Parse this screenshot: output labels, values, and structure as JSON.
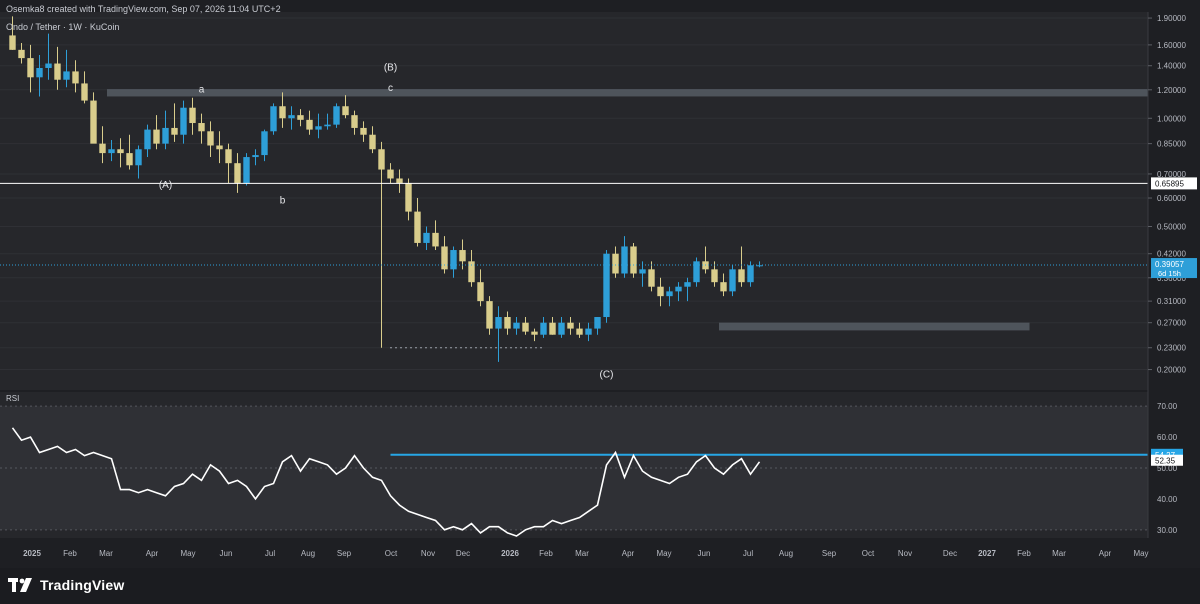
{
  "header": {
    "credit": "Osemka8 created with TradingView.com, Sep 07, 2026 11:04 UTC+2"
  },
  "footer": {
    "brand": "TradingView"
  },
  "colors": {
    "background": "#1e1f23",
    "panel": "#26272b",
    "bull": "#2e9fd8",
    "bear": "#d9cd8c",
    "rsi_line": "#ffffff",
    "highlight": "#27a6e6",
    "zone": "#6f7a84"
  },
  "chart_data": [
    {
      "type": "candlestick",
      "title": "Ondo / Tether · 1W · KuCoin",
      "scale": "log",
      "ylim": [
        0.18,
        1.95
      ],
      "y_ticks": [
        "1.90000",
        "1.60000",
        "1.40000",
        "1.20000",
        "1.00000",
        "0.85000",
        "0.70000",
        "0.60000",
        "0.50000",
        "0.42000",
        "0.36000",
        "0.31000",
        "0.27000",
        "0.23000",
        "0.20000"
      ],
      "y_tick_values": [
        1.9,
        1.6,
        1.4,
        1.2,
        1.0,
        0.85,
        0.7,
        0.6,
        0.5,
        0.42,
        0.36,
        0.31,
        0.27,
        0.23,
        0.2
      ],
      "x_labels": [
        "2025",
        "Feb",
        "Mar",
        "Apr",
        "May",
        "Jun",
        "Jul",
        "Aug",
        "Sep",
        "Oct",
        "Nov",
        "Dec",
        "2026",
        "Feb",
        "Mar",
        "Apr",
        "May",
        "Jun",
        "Jul",
        "Aug",
        "Sep",
        "Oct",
        "Nov",
        "Dec",
        "2027",
        "Feb",
        "Mar",
        "Apr",
        "May"
      ],
      "ohlc": [
        [
          1.7,
          1.92,
          1.55,
          1.55
        ],
        [
          1.55,
          1.62,
          1.42,
          1.47
        ],
        [
          1.47,
          1.6,
          1.18,
          1.3
        ],
        [
          1.3,
          1.5,
          1.15,
          1.38
        ],
        [
          1.38,
          1.72,
          1.28,
          1.42
        ],
        [
          1.42,
          1.58,
          1.2,
          1.28
        ],
        [
          1.28,
          1.55,
          1.22,
          1.35
        ],
        [
          1.35,
          1.45,
          1.18,
          1.25
        ],
        [
          1.25,
          1.35,
          1.1,
          1.12
        ],
        [
          1.12,
          1.18,
          0.86,
          0.85
        ],
        [
          0.85,
          0.95,
          0.75,
          0.8
        ],
        [
          0.8,
          0.87,
          0.76,
          0.82
        ],
        [
          0.82,
          0.88,
          0.73,
          0.8
        ],
        [
          0.8,
          0.9,
          0.72,
          0.74
        ],
        [
          0.74,
          0.84,
          0.68,
          0.82
        ],
        [
          0.82,
          0.96,
          0.78,
          0.93
        ],
        [
          0.93,
          1.02,
          0.82,
          0.85
        ],
        [
          0.85,
          1.05,
          0.82,
          0.94
        ],
        [
          0.94,
          1.1,
          0.86,
          0.9
        ],
        [
          0.9,
          1.12,
          0.85,
          1.07
        ],
        [
          1.07,
          1.14,
          0.9,
          0.97
        ],
        [
          0.97,
          1.03,
          0.85,
          0.92
        ],
        [
          0.92,
          0.98,
          0.78,
          0.84
        ],
        [
          0.84,
          0.92,
          0.75,
          0.82
        ],
        [
          0.82,
          0.85,
          0.66,
          0.75
        ],
        [
          0.75,
          0.8,
          0.62,
          0.66
        ],
        [
          0.66,
          0.8,
          0.65,
          0.78
        ],
        [
          0.78,
          0.82,
          0.74,
          0.79
        ],
        [
          0.79,
          0.93,
          0.76,
          0.92
        ],
        [
          0.92,
          1.1,
          0.9,
          1.08
        ],
        [
          1.08,
          1.18,
          0.94,
          1.0
        ],
        [
          1.0,
          1.08,
          0.93,
          1.02
        ],
        [
          1.02,
          1.06,
          0.95,
          0.99
        ],
        [
          0.99,
          1.05,
          0.9,
          0.93
        ],
        [
          0.93,
          1.03,
          0.88,
          0.95
        ],
        [
          0.95,
          1.03,
          0.93,
          0.96
        ],
        [
          0.96,
          1.1,
          0.94,
          1.08
        ],
        [
          1.08,
          1.16,
          1.0,
          1.02
        ],
        [
          1.02,
          1.05,
          0.9,
          0.94
        ],
        [
          0.94,
          0.98,
          0.86,
          0.9
        ],
        [
          0.9,
          0.95,
          0.8,
          0.82
        ],
        [
          0.82,
          0.86,
          0.23,
          0.72
        ],
        [
          0.72,
          0.75,
          0.66,
          0.68
        ],
        [
          0.68,
          0.72,
          0.62,
          0.66
        ],
        [
          0.66,
          0.68,
          0.52,
          0.55
        ],
        [
          0.55,
          0.6,
          0.44,
          0.45
        ],
        [
          0.45,
          0.5,
          0.43,
          0.48
        ],
        [
          0.48,
          0.52,
          0.43,
          0.44
        ],
        [
          0.44,
          0.47,
          0.37,
          0.38
        ],
        [
          0.38,
          0.44,
          0.36,
          0.43
        ],
        [
          0.43,
          0.46,
          0.38,
          0.4
        ],
        [
          0.4,
          0.43,
          0.34,
          0.35
        ],
        [
          0.35,
          0.38,
          0.3,
          0.31
        ],
        [
          0.31,
          0.32,
          0.25,
          0.26
        ],
        [
          0.26,
          0.3,
          0.21,
          0.28
        ],
        [
          0.28,
          0.29,
          0.25,
          0.26
        ],
        [
          0.26,
          0.28,
          0.25,
          0.27
        ],
        [
          0.27,
          0.28,
          0.25,
          0.255
        ],
        [
          0.255,
          0.26,
          0.24,
          0.25
        ],
        [
          0.25,
          0.28,
          0.245,
          0.27
        ],
        [
          0.27,
          0.28,
          0.25,
          0.25
        ],
        [
          0.25,
          0.28,
          0.245,
          0.27
        ],
        [
          0.27,
          0.28,
          0.25,
          0.26
        ],
        [
          0.26,
          0.27,
          0.245,
          0.25
        ],
        [
          0.25,
          0.27,
          0.24,
          0.26
        ],
        [
          0.26,
          0.28,
          0.25,
          0.28
        ],
        [
          0.28,
          0.43,
          0.27,
          0.42
        ],
        [
          0.42,
          0.44,
          0.36,
          0.37
        ],
        [
          0.37,
          0.47,
          0.36,
          0.44
        ],
        [
          0.44,
          0.45,
          0.36,
          0.37
        ],
        [
          0.37,
          0.4,
          0.34,
          0.38
        ],
        [
          0.38,
          0.4,
          0.33,
          0.34
        ],
        [
          0.34,
          0.36,
          0.3,
          0.32
        ],
        [
          0.32,
          0.34,
          0.3,
          0.33
        ],
        [
          0.33,
          0.35,
          0.31,
          0.34
        ],
        [
          0.34,
          0.36,
          0.31,
          0.35
        ],
        [
          0.35,
          0.41,
          0.34,
          0.4
        ],
        [
          0.4,
          0.44,
          0.37,
          0.38
        ],
        [
          0.38,
          0.4,
          0.34,
          0.35
        ],
        [
          0.35,
          0.37,
          0.32,
          0.33
        ],
        [
          0.33,
          0.39,
          0.32,
          0.38
        ],
        [
          0.38,
          0.44,
          0.34,
          0.35
        ],
        [
          0.35,
          0.4,
          0.34,
          0.39
        ],
        [
          0.39,
          0.4,
          0.385,
          0.39
        ]
      ],
      "price_lines": [
        {
          "label": "0.65895",
          "value": 0.65895,
          "color": "#ffffff"
        },
        {
          "label": "0.39057",
          "value": 0.39057,
          "color": "#2e9fd8",
          "sub": "6d 15h"
        }
      ],
      "zones": [
        {
          "from_bar": 11,
          "to_bar": 160,
          "low": 1.15,
          "high": 1.205
        },
        {
          "from_bar": 79,
          "to_bar": 113,
          "low": 0.257,
          "high": 0.27
        }
      ],
      "annotations": [
        {
          "text": "(A)",
          "bar": 17,
          "value": 0.64,
          "pos": "below"
        },
        {
          "text": "a",
          "bar": 21,
          "value": 1.18,
          "pos": "above"
        },
        {
          "text": "b",
          "bar": 30,
          "value": 0.58,
          "pos": "below"
        },
        {
          "text": "(B)",
          "bar": 42,
          "value": 1.36,
          "pos": "above"
        },
        {
          "text": "c",
          "bar": 42,
          "value": 1.19,
          "pos": "above"
        },
        {
          "text": "(C)",
          "bar": 66,
          "value": 0.19,
          "pos": "below"
        }
      ]
    },
    {
      "type": "line",
      "title": "RSI",
      "ylim": [
        28,
        72
      ],
      "y_ticks": [
        "70.00",
        "60.00",
        "50.00",
        "40.00",
        "30.00"
      ],
      "y_tick_values": [
        70,
        60,
        50,
        40,
        30
      ],
      "band": [
        30,
        70
      ],
      "values": [
        63,
        59,
        60,
        55,
        56,
        57,
        55,
        56,
        54,
        55,
        54,
        53,
        43,
        43,
        42,
        43,
        42,
        41,
        44,
        45,
        48,
        46,
        51,
        49,
        45,
        46,
        44,
        40,
        44,
        45,
        52,
        54,
        49,
        53,
        52,
        51,
        48,
        50,
        54,
        50,
        47,
        46,
        41,
        38,
        36,
        35,
        34,
        33,
        30,
        31,
        30,
        32,
        29,
        31,
        31,
        29,
        28,
        30,
        31,
        31,
        33,
        32,
        33,
        34,
        36,
        38,
        51,
        55,
        47,
        54,
        49,
        47,
        46,
        45,
        47,
        48,
        52,
        54,
        50,
        48,
        51,
        53,
        48,
        52
      ],
      "levels": [
        {
          "label": "54.27",
          "value": 54.27,
          "color": "#27a6e6"
        },
        {
          "label": "52.35",
          "value": 52.35,
          "color": "#ffffff"
        }
      ]
    }
  ]
}
